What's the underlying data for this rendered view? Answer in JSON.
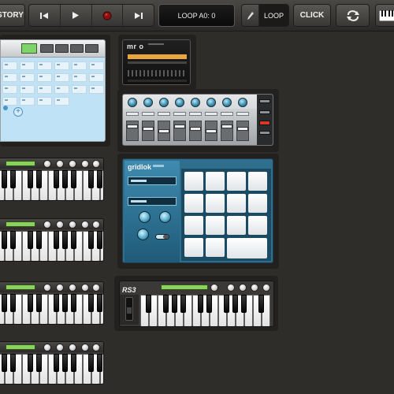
{
  "toolbar": {
    "history_label": "STORY",
    "lcd_text": "LOOP A0: 0",
    "loop_label": "LOOP",
    "click_label": "CLICK",
    "icons": {
      "rewind": "skip-back-icon",
      "play": "play-icon",
      "record": "record-icon",
      "forward": "skip-forward-icon",
      "pencil": "pencil-icon",
      "sync": "sync-icon",
      "keyboard": "keyboard-icon"
    },
    "record_color": "#b01818"
  },
  "modules": {
    "mro_title": "mr o",
    "gridlok_title": "gridlok",
    "rs3_label": "RS3"
  },
  "colors": {
    "background": "#2f2d29",
    "lcd_green": "#8ad25c",
    "mro_orange": "#e9a63d",
    "gridlok_blue": "#2f6f8d",
    "sequencer_blue": "#bfe2f7",
    "mixer_red": "#d23a2c"
  }
}
